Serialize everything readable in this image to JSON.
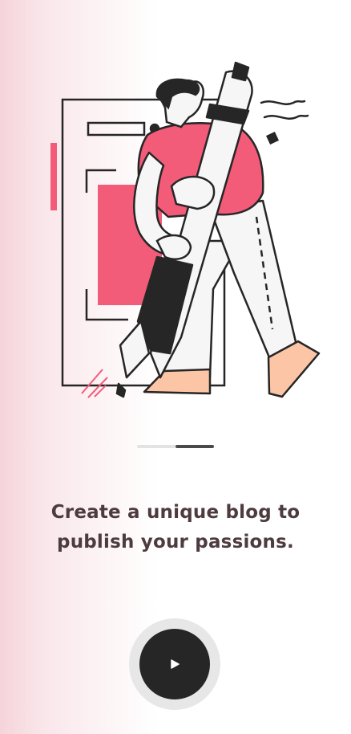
{
  "onboarding": {
    "headline_line1": "Create a unique blog to",
    "headline_line2": "publish your passions.",
    "pager": {
      "total": 2,
      "current": 2
    }
  },
  "next_button": {
    "icon": "play-icon"
  },
  "colors": {
    "accent": "#f25c78",
    "dark": "#262626",
    "skin": "#fcc5a5",
    "text": "#4d3b3e"
  }
}
